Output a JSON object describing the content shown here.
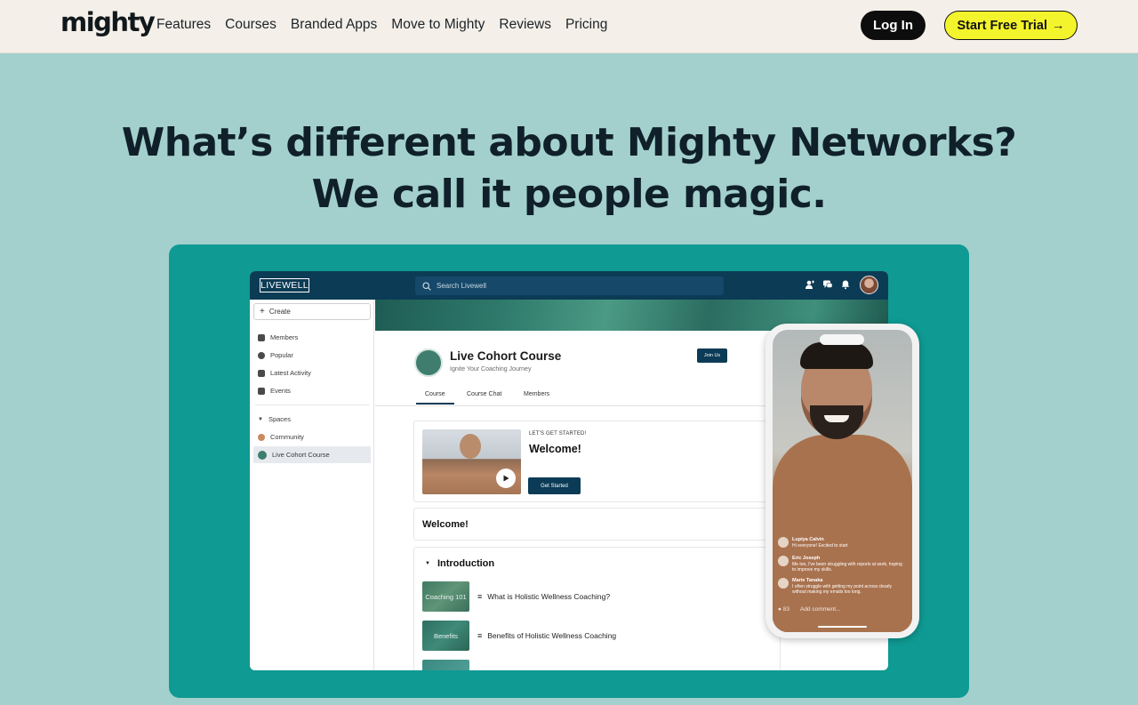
{
  "header": {
    "logo": "mighty",
    "nav": [
      "Features",
      "Courses",
      "Branded Apps",
      "Move to Mighty",
      "Reviews",
      "Pricing"
    ],
    "login_label": "Log In",
    "trial_label": "Start Free Trial",
    "trial_arrow": "→"
  },
  "hero": {
    "line1": "What’s different about Mighty Networks?",
    "line2": "We call it people magic."
  },
  "app": {
    "brand": "LIVEWELL",
    "search_placeholder": "Search Livewell",
    "create_label": "Create",
    "sidebar": {
      "items": [
        "Members",
        "Popular",
        "Latest Activity",
        "Events"
      ],
      "spaces_label": "Spaces",
      "spaces": [
        "Community",
        "Live Cohort  Course"
      ]
    },
    "course": {
      "title": "Live Cohort Course",
      "subtitle": "Ignite Your Coaching Journey",
      "join_label": "Join Us",
      "tabs": [
        "Course",
        "Course Chat",
        "Members"
      ],
      "kicker": "LET'S GET STARTED!",
      "welcome_title": "Welcome!",
      "get_started": "Get Started",
      "welcome_section": "Welcome!",
      "section_title": "Introduction",
      "lessons": [
        {
          "thumb": "Coaching 101",
          "name": "What is Holistic Wellness Coaching?"
        },
        {
          "thumb": "Benefits",
          "name": "Benefits of Holistic Wellness Coaching"
        }
      ]
    }
  },
  "phone": {
    "comments": [
      {
        "name": "Lupiya Calvin",
        "text": "Hi everyone! Excited to start"
      },
      {
        "name": "Eric Joseph",
        "text": "Me too, I've been struggling with reports at work, hoping to improve my skills."
      },
      {
        "name": "Marie Tanaka",
        "text": "I often struggle with getting my point across clearly without making my emails too long."
      }
    ],
    "count": "83",
    "add_comment": "Add comment..."
  },
  "colors": {
    "header_bg": "#f4efe8",
    "page_bg": "#a3d0cd",
    "stage_bg": "#0f9a93",
    "app_bar": "#0c3b55",
    "trial_yellow": "#f4f42c"
  }
}
